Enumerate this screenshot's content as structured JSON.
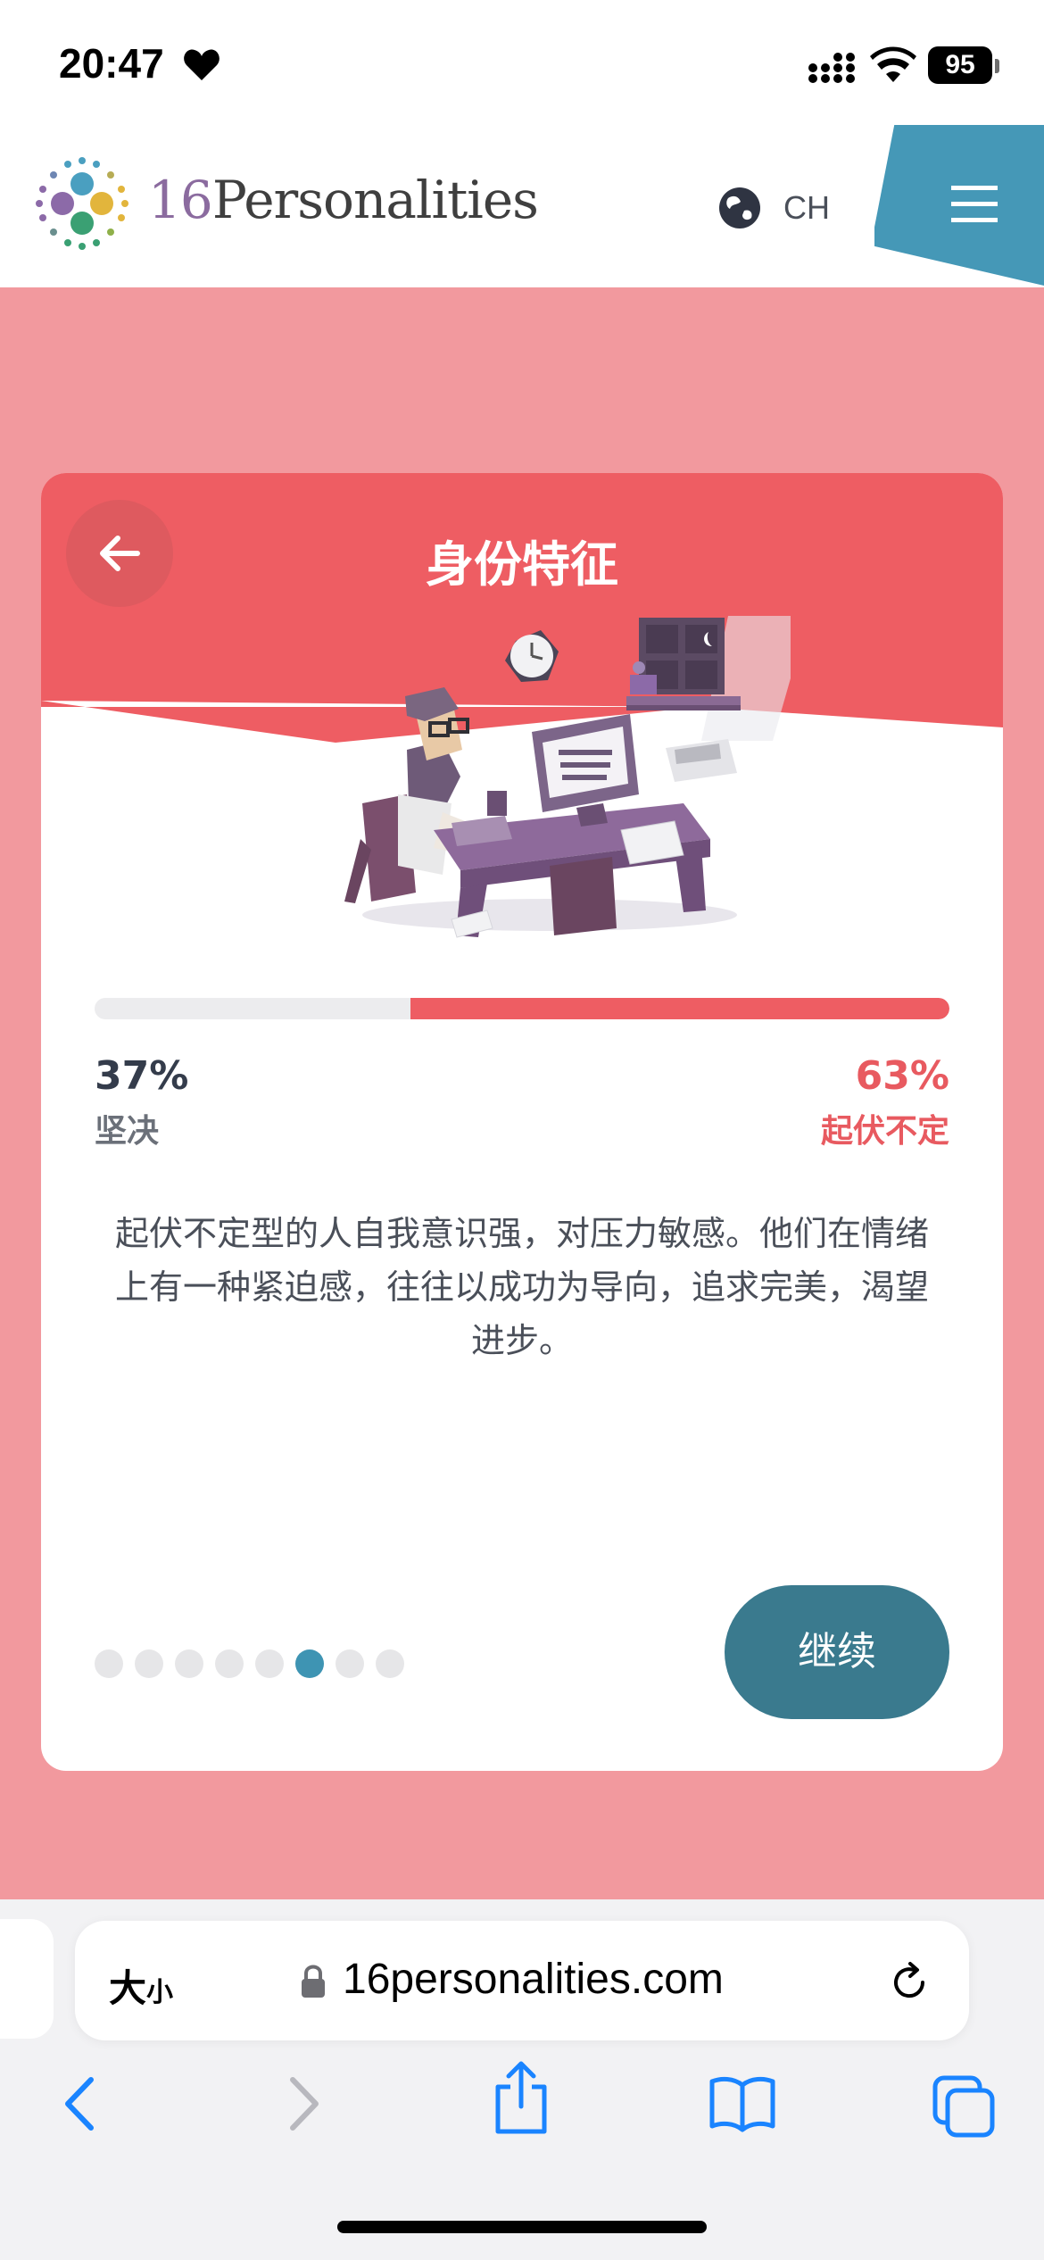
{
  "status_bar": {
    "time": "20:47",
    "battery": "95"
  },
  "header": {
    "logo_number": "16",
    "logo_word": "Personalities",
    "language": "CH"
  },
  "card": {
    "title": "身份特征",
    "progress": {
      "left_percent": "37%",
      "left_label": "坚决",
      "right_percent": "63%",
      "right_label": "起伏不定",
      "right_value": 0.63
    },
    "description": "起伏不定型的人自我意识强，对压力敏感。他们在情绪上有一种紧迫感，往往以成功为导向，追求完美，渴望进步。",
    "pager": {
      "total": 8,
      "active_index": 5
    },
    "continue_label": "继续"
  },
  "browser": {
    "text_size_big": "大",
    "text_size_small": "小",
    "url": "16personalities.com"
  },
  "colors": {
    "page_bg": "#f2999e",
    "accent_red": "#ee5d63",
    "accent_teal": "#3a7a8e",
    "menu_blue": "#4598b7",
    "ios_blue": "#1a84ff"
  },
  "icons": [
    "heart-icon",
    "signal-icon",
    "wifi-icon",
    "globe-icon",
    "hamburger-icon",
    "back-arrow-icon",
    "lock-icon",
    "reload-icon",
    "back-nav-icon",
    "forward-nav-icon",
    "share-icon",
    "bookmarks-icon",
    "tabs-icon"
  ]
}
